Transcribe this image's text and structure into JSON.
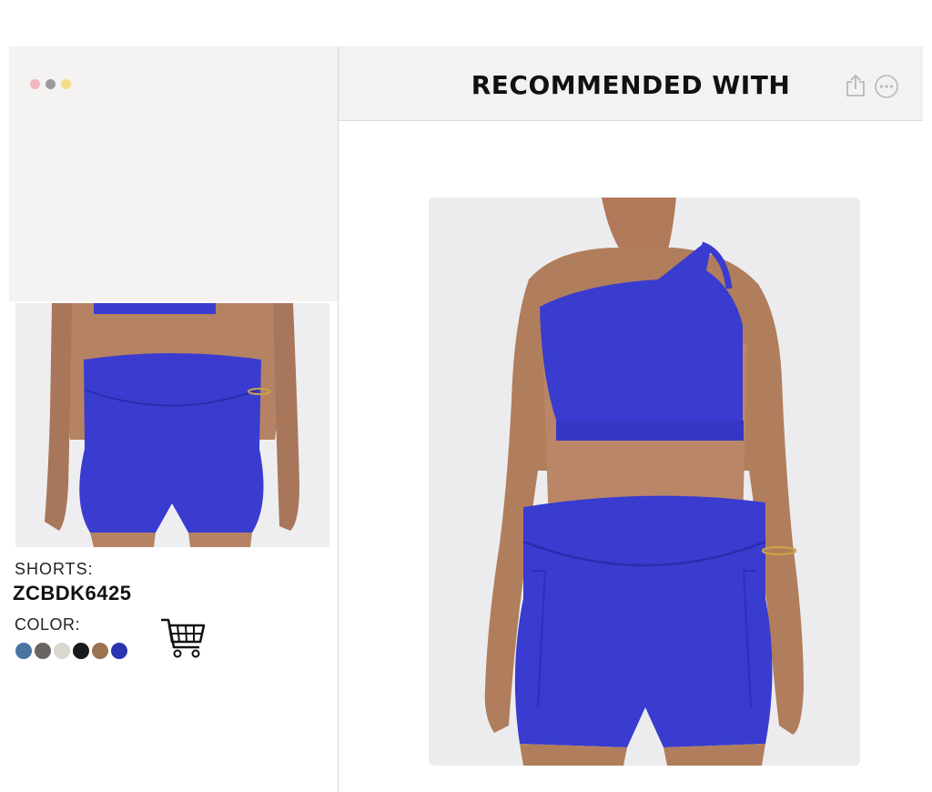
{
  "window": {
    "traffic_lights": [
      "#f0b8c2",
      "#9a9a9a",
      "#f5dc8a"
    ]
  },
  "header": {
    "title": "RECOMMENDED WITH",
    "share_icon": "share-icon",
    "more_icon": "more-options-icon"
  },
  "product": {
    "category_label": "SHORTS:",
    "sku": "ZCBDK6425",
    "color_label": "COLOR:",
    "color_swatches": [
      "#4a74a2",
      "#6a6461",
      "#d9d8ce",
      "#1a1a1a",
      "#9c7350",
      "#2b33b0"
    ],
    "cart_icon": "shopping-cart-icon"
  },
  "colors": {
    "garment_blue": "#3a3ccf",
    "skin": "#b07e5c"
  }
}
